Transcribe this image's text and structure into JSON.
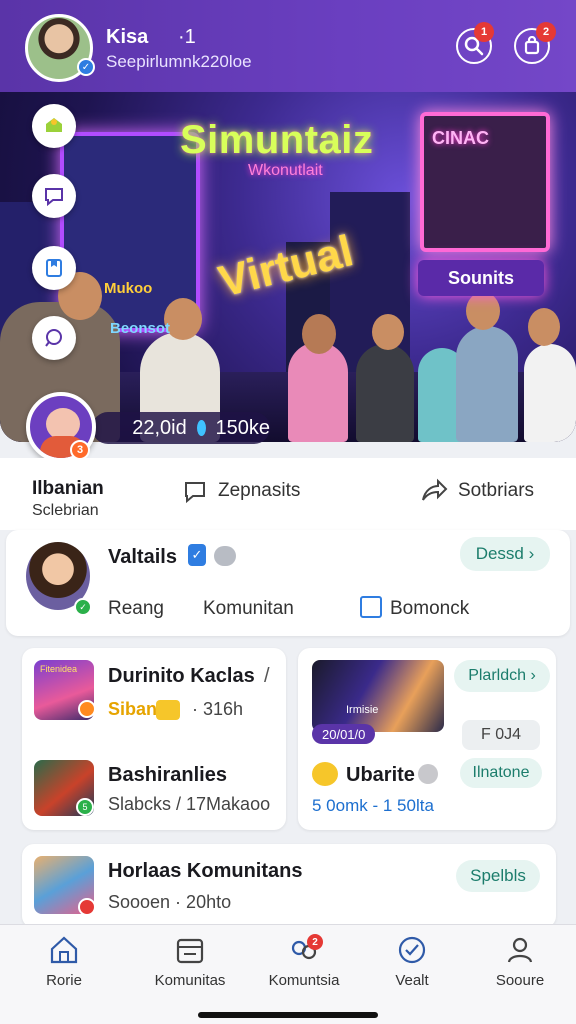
{
  "header": {
    "user_name": "Kisa",
    "user_count": "·1",
    "user_sub": "Seepirlumnk220loe",
    "search_badge": "1",
    "bag_badge": "2"
  },
  "banner": {
    "title": "Simuntaiz",
    "subtitle": "Wkonutlait",
    "neon_text": "Virtual",
    "store_sign": "CINAC",
    "store_label": "Sounits",
    "screen_label": "Mukoo",
    "screen_label2": "Beonsot",
    "stat_members": "22,0id",
    "stat_views": "150ke",
    "community_badge": "3"
  },
  "info": {
    "title": "Ilbanian",
    "subtitle": "Sclebrian",
    "link_posts": "Zepnasits",
    "link_share": "Sotbriars"
  },
  "profile_card": {
    "name": "Valtails",
    "action_label": "Dessd",
    "tabs": [
      "Reang",
      "Komunitan",
      "Bomonck"
    ]
  },
  "card_left": {
    "item1_title": "Durinito Kaclas",
    "item1_slash": "/",
    "item1_tag": "Siban",
    "item1_meta": "· 316h",
    "item1_thumb_label": "Fitenidea",
    "item2_title": "Bashiranlies",
    "item2_meta": "Slabcks  /  17Makaoo",
    "item2_badge": "5"
  },
  "card_right": {
    "thumb_label": "20/01/0",
    "thumb_text": "Irmisie",
    "action_label": "Plarldch",
    "code_label": "F 0J4",
    "item_title": "Ubarite",
    "item_meta": "5 0omk - 1 50lta",
    "item_action": "Ilnatone"
  },
  "card_bottom": {
    "title": "Horlaas Komunitans",
    "meta": "Soooen  ·  20hto",
    "action_label": "Spelbls"
  },
  "nav": {
    "items": [
      "Rorie",
      "Komunitas",
      "Komuntsia",
      "Vealt",
      "Sooure"
    ],
    "badge": "2"
  },
  "colors": {
    "header": "#6a3fc0",
    "accent_teal": "#1c7d6c",
    "badge_red": "#e53935"
  }
}
